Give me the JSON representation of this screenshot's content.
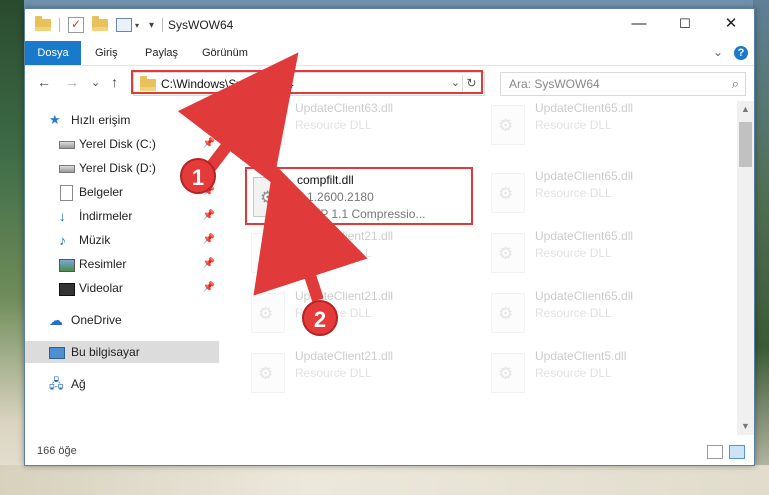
{
  "window": {
    "title": "SysWOW64",
    "controls": {
      "minimize": "—",
      "maximize": "☐",
      "close": "✕"
    }
  },
  "ribbon": {
    "tabs": [
      "Dosya",
      "Giriş",
      "Paylaş",
      "Görünüm"
    ],
    "collapse": "⌄",
    "help": "?"
  },
  "nav": {
    "back": "←",
    "forward": "→",
    "recent": "⌄",
    "up": "↑",
    "address": "C:\\Windows\\SysWOW64",
    "address_dropdown": "⌄",
    "refresh": "↻",
    "search_placeholder": "Ara: SysWOW64",
    "search_icon": "⌕"
  },
  "sidebar": {
    "items": [
      {
        "label": "Hızlı erişim",
        "icon": "star-icon",
        "pinned": false
      },
      {
        "label": "Yerel Disk (C:)",
        "icon": "drive-icon",
        "pinned": true
      },
      {
        "label": "Yerel Disk (D:)",
        "icon": "drive-icon",
        "pinned": true
      },
      {
        "label": "Belgeler",
        "icon": "documents-icon",
        "pinned": true
      },
      {
        "label": "İndirmeler",
        "icon": "downloads-icon",
        "pinned": true
      },
      {
        "label": "Müzik",
        "icon": "music-icon",
        "pinned": true
      },
      {
        "label": "Resimler",
        "icon": "pictures-icon",
        "pinned": true
      },
      {
        "label": "Videolar",
        "icon": "videos-icon",
        "pinned": true
      },
      {
        "label": "OneDrive",
        "icon": "cloud-icon",
        "pinned": false
      },
      {
        "label": "Bu bilgisayar",
        "icon": "computer-icon",
        "pinned": false,
        "selected": true
      },
      {
        "label": "Ağ",
        "icon": "network-icon",
        "pinned": false
      }
    ]
  },
  "files": {
    "selected": {
      "name": "compfilt.dll",
      "version": "5.1.2600.2180",
      "description": "HTTP 1.1 Compressio..."
    },
    "faded": [
      {
        "name": "UpdateClient63.dll",
        "desc": "Resource DLL"
      },
      {
        "name": "UpdateClient65.dll",
        "desc": "Resource DLL"
      },
      {
        "name": "UpdateClient65.dll",
        "desc": "Resource DLL"
      },
      {
        "name": "UpdateClient21.dll",
        "desc": "Resource DLL"
      },
      {
        "name": "UpdateClient65.dll",
        "desc": "Resource DLL"
      },
      {
        "name": "UpdateClient21.dll",
        "desc": "Resource DLL"
      },
      {
        "name": "UpdateClient65.dll",
        "desc": "Resource DLL"
      },
      {
        "name": "UpdateClient21.dll",
        "desc": "Resource DLL"
      },
      {
        "name": "UpdateClient5.dll",
        "desc": "Resource DLL"
      }
    ]
  },
  "status": {
    "count": "166 öğe"
  },
  "callouts": {
    "one": "1",
    "two": "2",
    "color": "#e03a3a"
  }
}
